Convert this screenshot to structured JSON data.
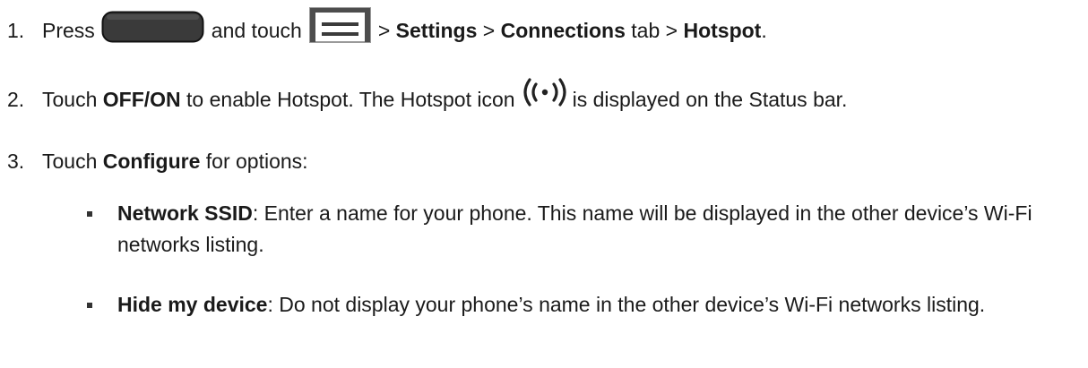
{
  "steps": [
    {
      "number": "1.",
      "text_press": "Press",
      "home_button_icon": "home-button-icon",
      "text_and_touch": "and touch",
      "menu_icon": "menu-icon",
      "sep1": ">",
      "settings": "Settings",
      "sep2": ">",
      "connections": "Connections",
      "text_tab": "tab >",
      "hotspot": "Hotspot",
      "period": "."
    },
    {
      "number": "2.",
      "text_touch": "Touch",
      "offon": "OFF/ON",
      "text_enable": "to enable Hotspot. The Hotspot icon",
      "hotspot_icon": "hotspot-icon",
      "text_displayed": "is displayed on the Status bar."
    },
    {
      "number": "3.",
      "text_touch": "Touch",
      "configure": "Configure",
      "text_options": "for options:"
    }
  ],
  "options": [
    {
      "title": "Network SSID",
      "description": ": Enter a name for your phone. This name will be displayed in the other device’s Wi-Fi networks listing."
    },
    {
      "title": "Hide my device",
      "description": ": Do not display your phone’s name in the other device’s Wi-Fi networks listing."
    }
  ],
  "colors": {
    "text": "#1a1a1a",
    "home_button": "#3a3a3a",
    "menu_icon_border": "#4d4d4d",
    "hotspot_icon": "#222222"
  }
}
